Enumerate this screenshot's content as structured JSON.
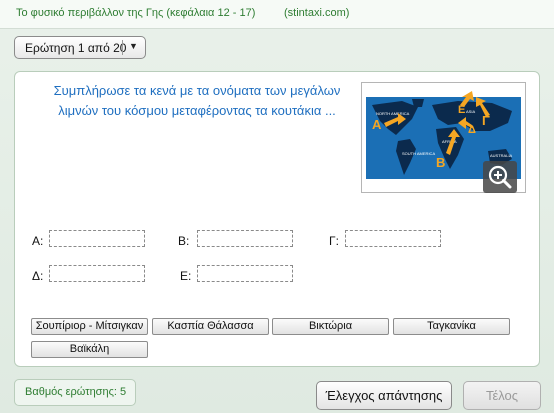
{
  "header": {
    "title": "Το φυσικό περιβάλλον της Γης  (κεφάλαια 12 - 17)",
    "site": "(stintaxi.com)"
  },
  "question_selector": {
    "label": "Ερώτηση 1 από 20"
  },
  "instruction": "Συμπλήρωσε τα κενά με τα ονόματα των μεγάλων λιμνών του κόσμου μεταφέροντας τα κουτάκια ...",
  "map": {
    "markers": [
      "A",
      "B",
      "Γ",
      "Δ",
      "E"
    ],
    "zoom_icon": "zoom-in-icon"
  },
  "blanks": [
    {
      "label": "Α:",
      "value": ""
    },
    {
      "label": "Β:",
      "value": ""
    },
    {
      "label": "Γ:",
      "value": ""
    },
    {
      "label": "Δ:",
      "value": ""
    },
    {
      "label": "Ε:",
      "value": ""
    }
  ],
  "choices": [
    "Σουπίριορ - Μίτσιγκαν",
    "Κασπία Θάλασσα",
    "Βικτώρια",
    "Ταγκανίκα",
    "Βαϊκάλη"
  ],
  "footer": {
    "grade_label": "Βαθμός ερώτησης: 5",
    "check_button": "Έλεγχος απάντησης",
    "end_button": "Τέλος"
  },
  "colors": {
    "accent_green": "#2e7d32",
    "instruction_blue": "#1f6fc0",
    "map_ocean": "#1b6fb5",
    "map_land": "#0b2a4d",
    "marker_orange": "#f5a623"
  }
}
